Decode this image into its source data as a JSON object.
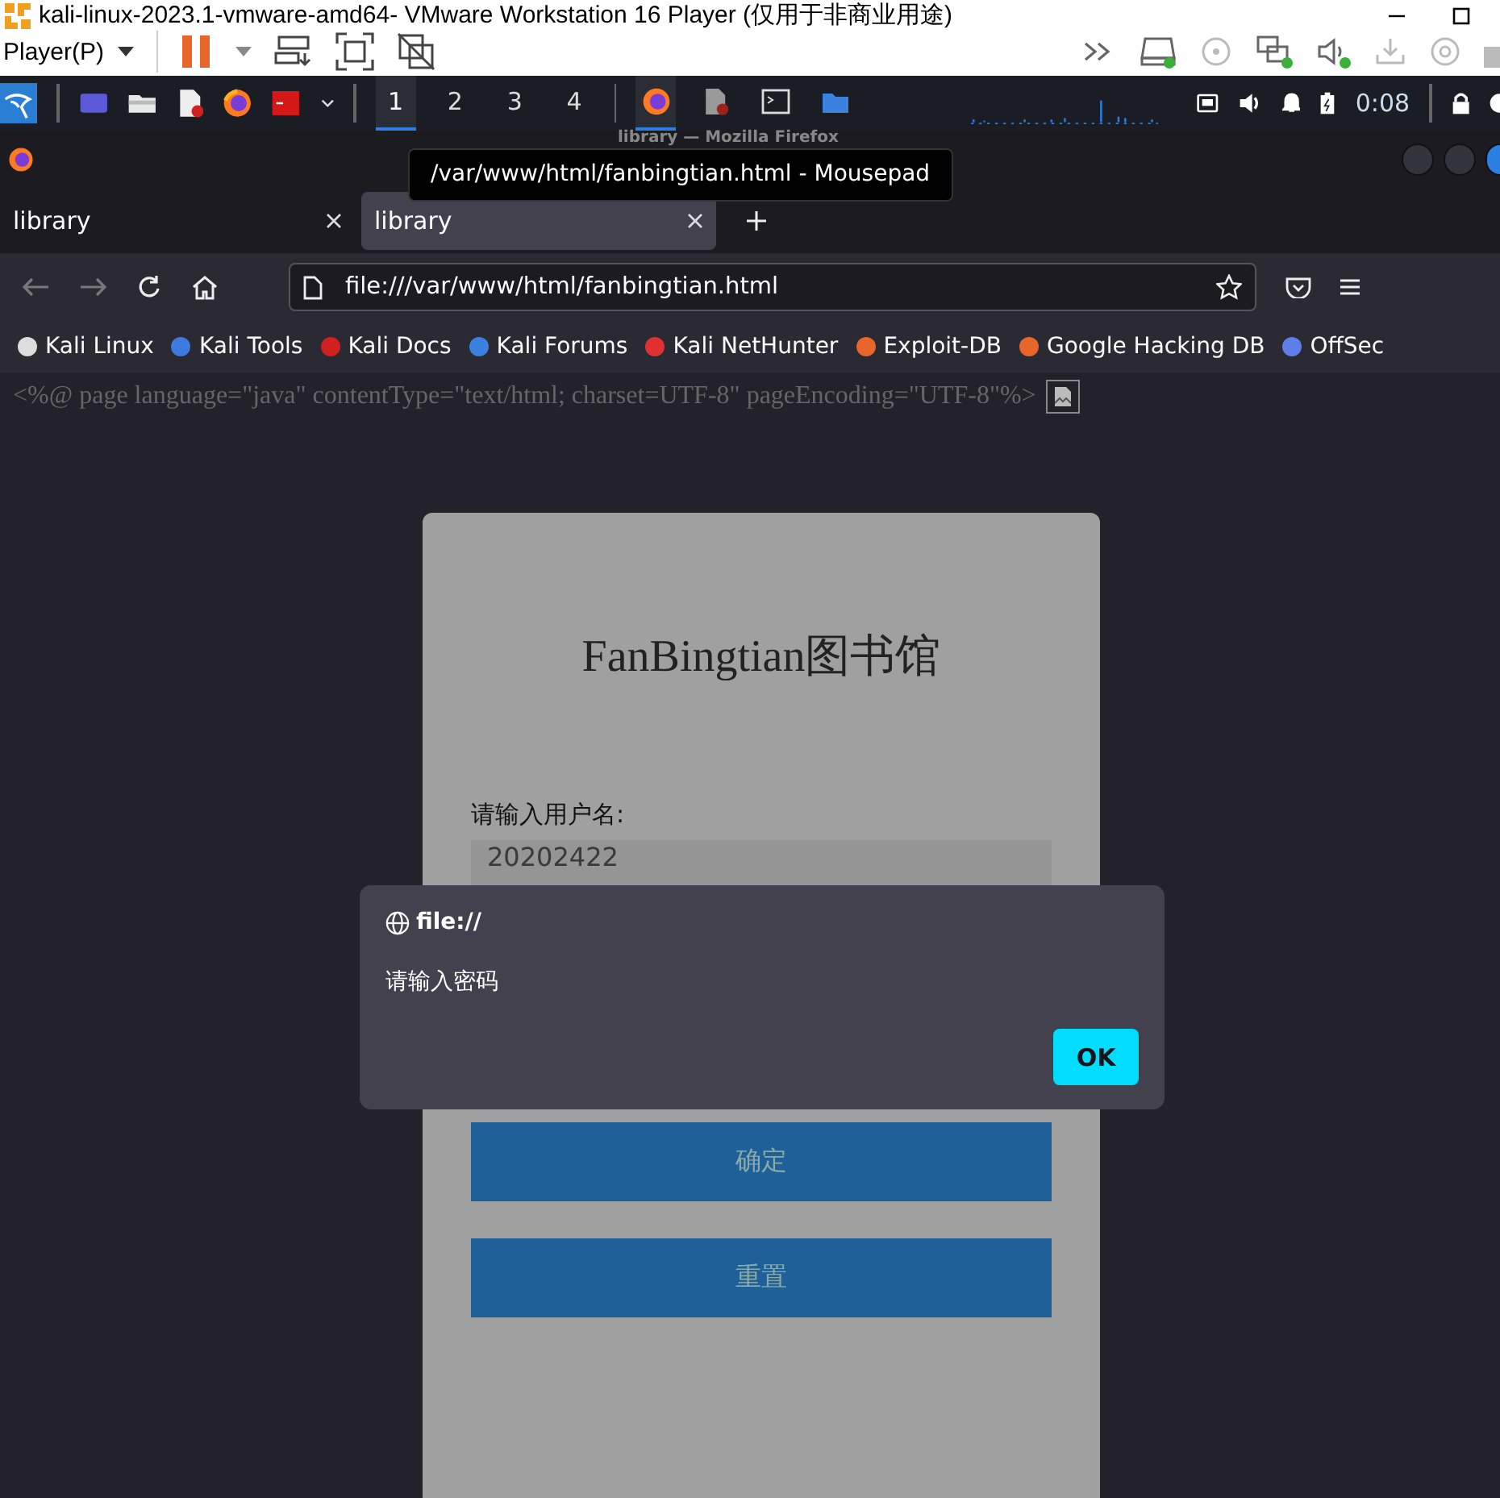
{
  "vm_window": {
    "title": "kali-linux-2023.1-vmware-amd64- VMware Workstation 16 Player (仅用于非商业用途)",
    "menu": "Player(P)"
  },
  "kali_panel": {
    "workspaces": [
      {
        "label": "1",
        "selected": true
      },
      {
        "label": "2",
        "selected": false
      },
      {
        "label": "3",
        "selected": false
      },
      {
        "label": "4",
        "selected": false
      }
    ],
    "clock": "0:08"
  },
  "firefox": {
    "title": "library — Mozilla Firefox",
    "tooltip": "/var/www/html/fanbingtian.html - Mousepad",
    "tabs": [
      {
        "label": "library",
        "selected": false
      },
      {
        "label": "library",
        "selected": true
      }
    ],
    "url": "file:///var/www/html/fanbingtian.html",
    "bookmarks": [
      {
        "label": "Kali Linux",
        "color": "#dddddd"
      },
      {
        "label": "Kali Tools",
        "color": "#3d7be0"
      },
      {
        "label": "Kali Docs",
        "color": "#d02020"
      },
      {
        "label": "Kali Forums",
        "color": "#3b82e0"
      },
      {
        "label": "Kali NetHunter",
        "color": "#e03030"
      },
      {
        "label": "Exploit-DB",
        "color": "#e8662a"
      },
      {
        "label": "Google Hacking DB",
        "color": "#e8662a"
      },
      {
        "label": "OffSec",
        "color": "#5f7fe8"
      }
    ]
  },
  "page": {
    "raw_text": "<%@ page language=\"java\" contentType=\"text/html; charset=UTF-8\" pageEncoding=\"UTF-8\"%>",
    "heading": "FanBingtian图书馆",
    "username_label": "请输入用户名:",
    "username_value": "20202422",
    "buttons": [
      "确定",
      "重置"
    ]
  },
  "dialog": {
    "origin": "file://",
    "message": "请输入密码",
    "button": "OK"
  }
}
